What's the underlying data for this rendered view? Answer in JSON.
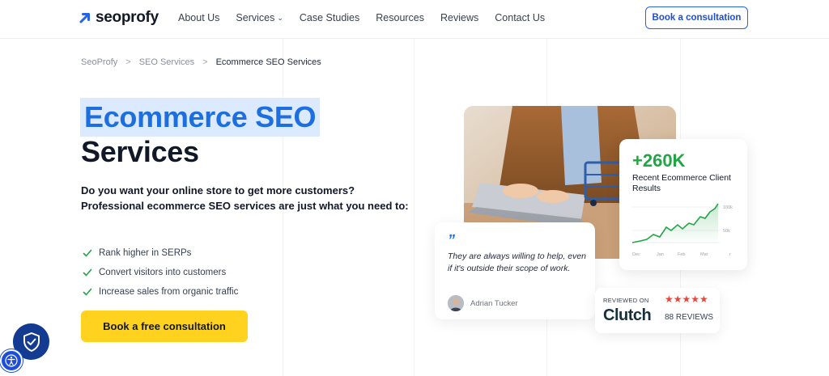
{
  "brand": {
    "name": "seoprofy",
    "accent": "#1d6fe0"
  },
  "nav": {
    "items": [
      {
        "label": "About Us"
      },
      {
        "label": "Services"
      },
      {
        "label": "Case Studies"
      },
      {
        "label": "Resources"
      },
      {
        "label": "Reviews"
      },
      {
        "label": "Contact Us"
      }
    ],
    "cta_label": "Book a consultation"
  },
  "breadcrumb": {
    "items": [
      "SeoProfy",
      "SEO Services",
      "Ecommerce SEO Services"
    ],
    "separator": ">"
  },
  "hero": {
    "title_highlight": "Ecommerce SEO",
    "title_rest": "Services",
    "lead": "Do you want your online store to get more customers? Professional ecommerce SEO services are just what you need to:",
    "benefits": [
      "Rank higher in SERPs",
      "Convert visitors into customers",
      "Increase sales from organic traffic"
    ],
    "cta_label": "Book a free consultation"
  },
  "stat_card": {
    "value": "+260K",
    "label": "Recent Ecommerce Client Results",
    "chart": {
      "y_ticks": [
        "100k",
        "50k"
      ],
      "x_ticks": [
        "Dec",
        "Jan",
        "Feb",
        "Mar",
        "r"
      ],
      "line_color": "#22a545"
    }
  },
  "testimonial": {
    "quote_mark": "”",
    "text": "They are always willing to help, even if it's outside their scope of work.",
    "author": "Adrian Tucker"
  },
  "clutch": {
    "reviewed_on": "REVIEWED ON",
    "logo": "Clutch",
    "stars": "★★★★★",
    "reviews": "88 REVIEWS"
  },
  "colors": {
    "primary_blue": "#1d6fe0",
    "cta_yellow": "#ffd21f",
    "success_green": "#22a545"
  }
}
